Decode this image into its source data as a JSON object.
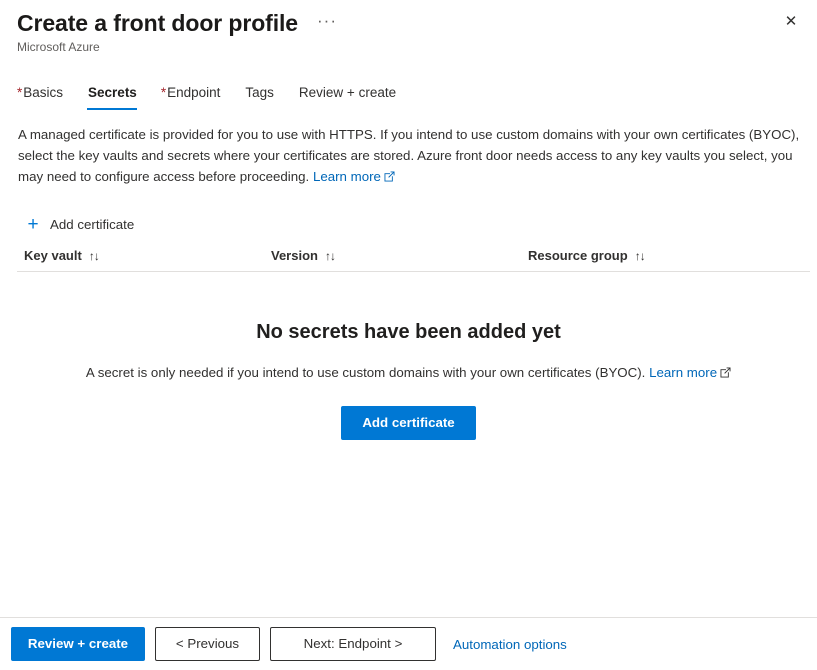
{
  "header": {
    "title": "Create a front door profile",
    "subtitle": "Microsoft Azure",
    "ellipsis_label": "···",
    "close_label": "✕"
  },
  "tabs": [
    {
      "required": "*",
      "label": "Basics",
      "active": false
    },
    {
      "required": "",
      "label": "Secrets",
      "active": true
    },
    {
      "required": "*",
      "label": "Endpoint",
      "active": false
    },
    {
      "required": "",
      "label": "Tags",
      "active": false
    },
    {
      "required": "",
      "label": "Review + create",
      "active": false
    }
  ],
  "description": {
    "text": "A managed certificate is provided for you to use with HTTPS. If you intend to use custom domains with your own certificates (BYOC), select the key vaults and secrets where your certificates are stored. Azure front door needs access to any key vaults you select, you may need to configure access before proceeding.",
    "learn_more": "Learn more"
  },
  "command_bar": {
    "add_certificate_label": "Add certificate",
    "plus_icon": "+"
  },
  "table": {
    "columns": [
      {
        "label": "Key vault",
        "sort": "↑↓"
      },
      {
        "label": "Version",
        "sort": "↑↓"
      },
      {
        "label": "Resource group",
        "sort": "↑↓"
      }
    ],
    "rows": []
  },
  "empty_state": {
    "title": "No secrets have been added yet",
    "subtitle": "A secret is only needed if you intend to use custom domains with your own certificates (BYOC).",
    "learn_more": "Learn more",
    "action_label": "Add certificate"
  },
  "footer": {
    "review_create": "Review + create",
    "previous": "< Previous",
    "next": "Next: Endpoint >",
    "automation_options": "Automation options"
  },
  "colors": {
    "accent": "#0078d4",
    "link": "#0067b8",
    "required_asterisk": "#a4262c",
    "divider": "#e1dfdd",
    "text": "#323130"
  }
}
